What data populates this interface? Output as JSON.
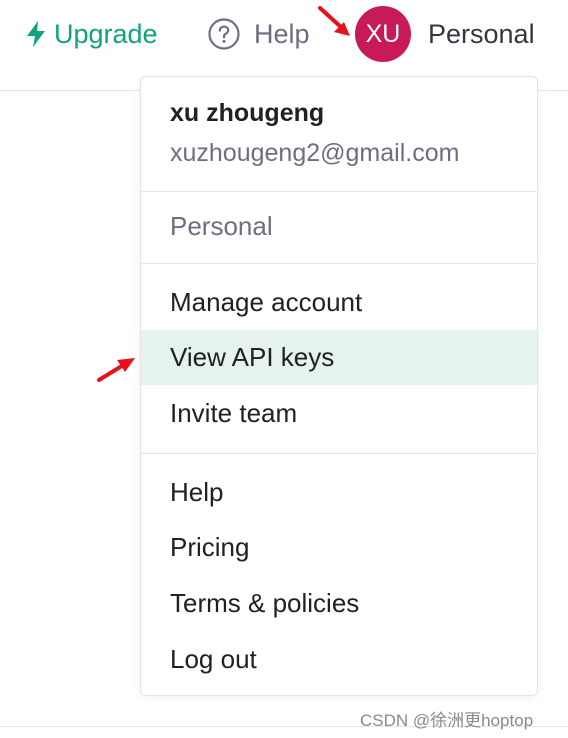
{
  "header": {
    "upgrade_label": "Upgrade",
    "help_label": "Help",
    "avatar_initials": "XU",
    "account_label": "Personal"
  },
  "menu": {
    "user_name": "xu zhougeng",
    "user_email": "xuzhougeng2@gmail.com",
    "org_label": "Personal",
    "account_items": [
      {
        "label": "Manage account"
      },
      {
        "label": "View API keys",
        "highlighted": true
      },
      {
        "label": "Invite team"
      }
    ],
    "footer_items": [
      {
        "label": "Help"
      },
      {
        "label": "Pricing"
      },
      {
        "label": "Terms & policies"
      },
      {
        "label": "Log out"
      }
    ]
  },
  "annotations": {
    "arrow_color": "#e8101b"
  },
  "watermark": "CSDN @徐洲更hoptop",
  "colors": {
    "brand_green": "#10a37f",
    "avatar_bg": "#c8195a",
    "highlight_bg": "#e6f2f0"
  }
}
